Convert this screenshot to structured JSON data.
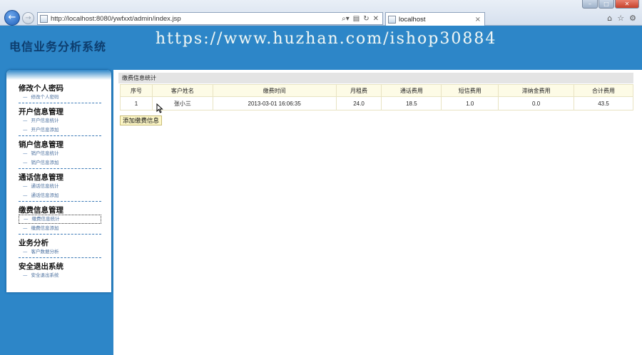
{
  "browser": {
    "url": "http://localhost:8080/ywfxxt/admin/index.jsp",
    "tab_title": "localhost",
    "tab_close": "×"
  },
  "app": {
    "title": "电信业务分析系统",
    "watermark": "https://www.huzhan.com/ishop30884"
  },
  "sidebar": {
    "groups": [
      {
        "title": "修改个人密码",
        "items": [
          "修改个人密码"
        ]
      },
      {
        "title": "开户信息管理",
        "items": [
          "开户信息统计",
          "开户信息添加"
        ]
      },
      {
        "title": "销户信息管理",
        "items": [
          "销户信息统计",
          "销户信息添加"
        ]
      },
      {
        "title": "通话信息管理",
        "items": [
          "通话信息统计",
          "通话信息添加"
        ]
      },
      {
        "title": "缴费信息管理",
        "items": [
          "缴费信息统计",
          "缴费信息添加"
        ]
      },
      {
        "title": "业务分析",
        "items": [
          "客户数据分析"
        ]
      },
      {
        "title": "安全退出系统",
        "items": [
          "安全退出系统"
        ]
      }
    ]
  },
  "main": {
    "panel_title": "缴费信息统计",
    "table": {
      "headers": [
        "序号",
        "客户姓名",
        "缴费时间",
        "月租费",
        "通话费用",
        "短信费用",
        "滞纳金费用",
        "合计费用"
      ],
      "rows": [
        [
          "1",
          "张小三",
          "2013-03-01 16:06:35",
          "24.0",
          "18.5",
          "1.0",
          "0.0",
          "43.5"
        ]
      ]
    },
    "add_button": "添加缴费信息"
  }
}
